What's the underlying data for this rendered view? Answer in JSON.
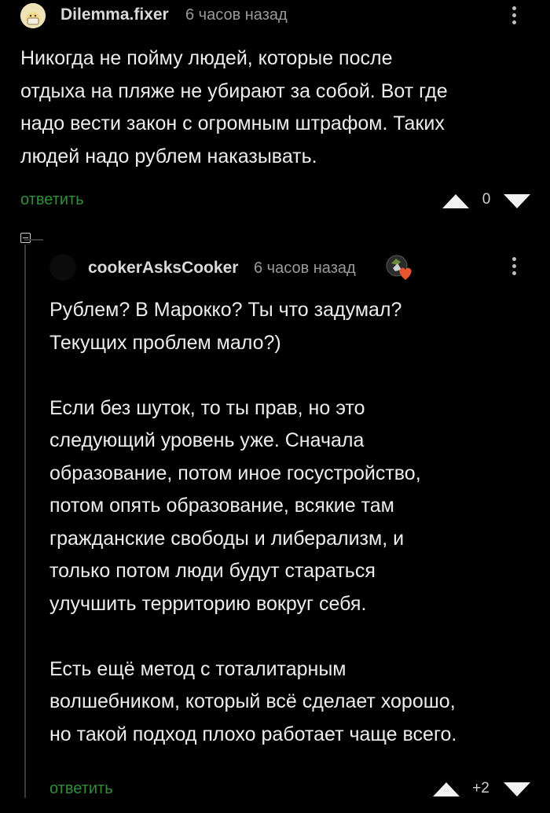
{
  "comment1": {
    "username": "Dilemma.fixer",
    "timestamp": "6 часов назад",
    "text": "Никогда не пойму людей, которые после\nотдыха на пляже не убирают за собой. Вот где\nнадо вести закон с огромным штрафом. Таких\nлюдей надо рублем наказывать.",
    "reply_label": "ответить",
    "score": "0"
  },
  "comment2": {
    "username": "cookerAsksCooker",
    "timestamp": "6 часов назад",
    "paragraphs": [
      "Рублем? В Марокко? Ты что задумал?\nТекущих проблем мало?)",
      "Если без шуток, то ты прав, но это\nследующий уровень уже. Сначала\nобразование, потом иное госустройство,\nпотом опять образование, всякие там\nгражданские свободы и либерализм, и\nтолько потом люди будут стараться\nулучшить территорию вокруг себя.",
      "Есть ещё метод с тоталитарным\nволшебником, который всё сделает хорошо,\nно такой подход плохо работает чаще всего."
    ],
    "reply_label": "ответить",
    "score": "+2"
  },
  "colors": {
    "background": "#000000",
    "reply_green": "#2f8f3a",
    "text": "#ededed",
    "muted": "#9a9a9a",
    "heart": "#e8542e"
  },
  "icons": {
    "more": "vertical-ellipsis-icon",
    "upvote": "triangle-up-icon",
    "downvote": "triangle-down-icon",
    "collapse": "minus-box-icon",
    "badge": "heart-icon"
  }
}
